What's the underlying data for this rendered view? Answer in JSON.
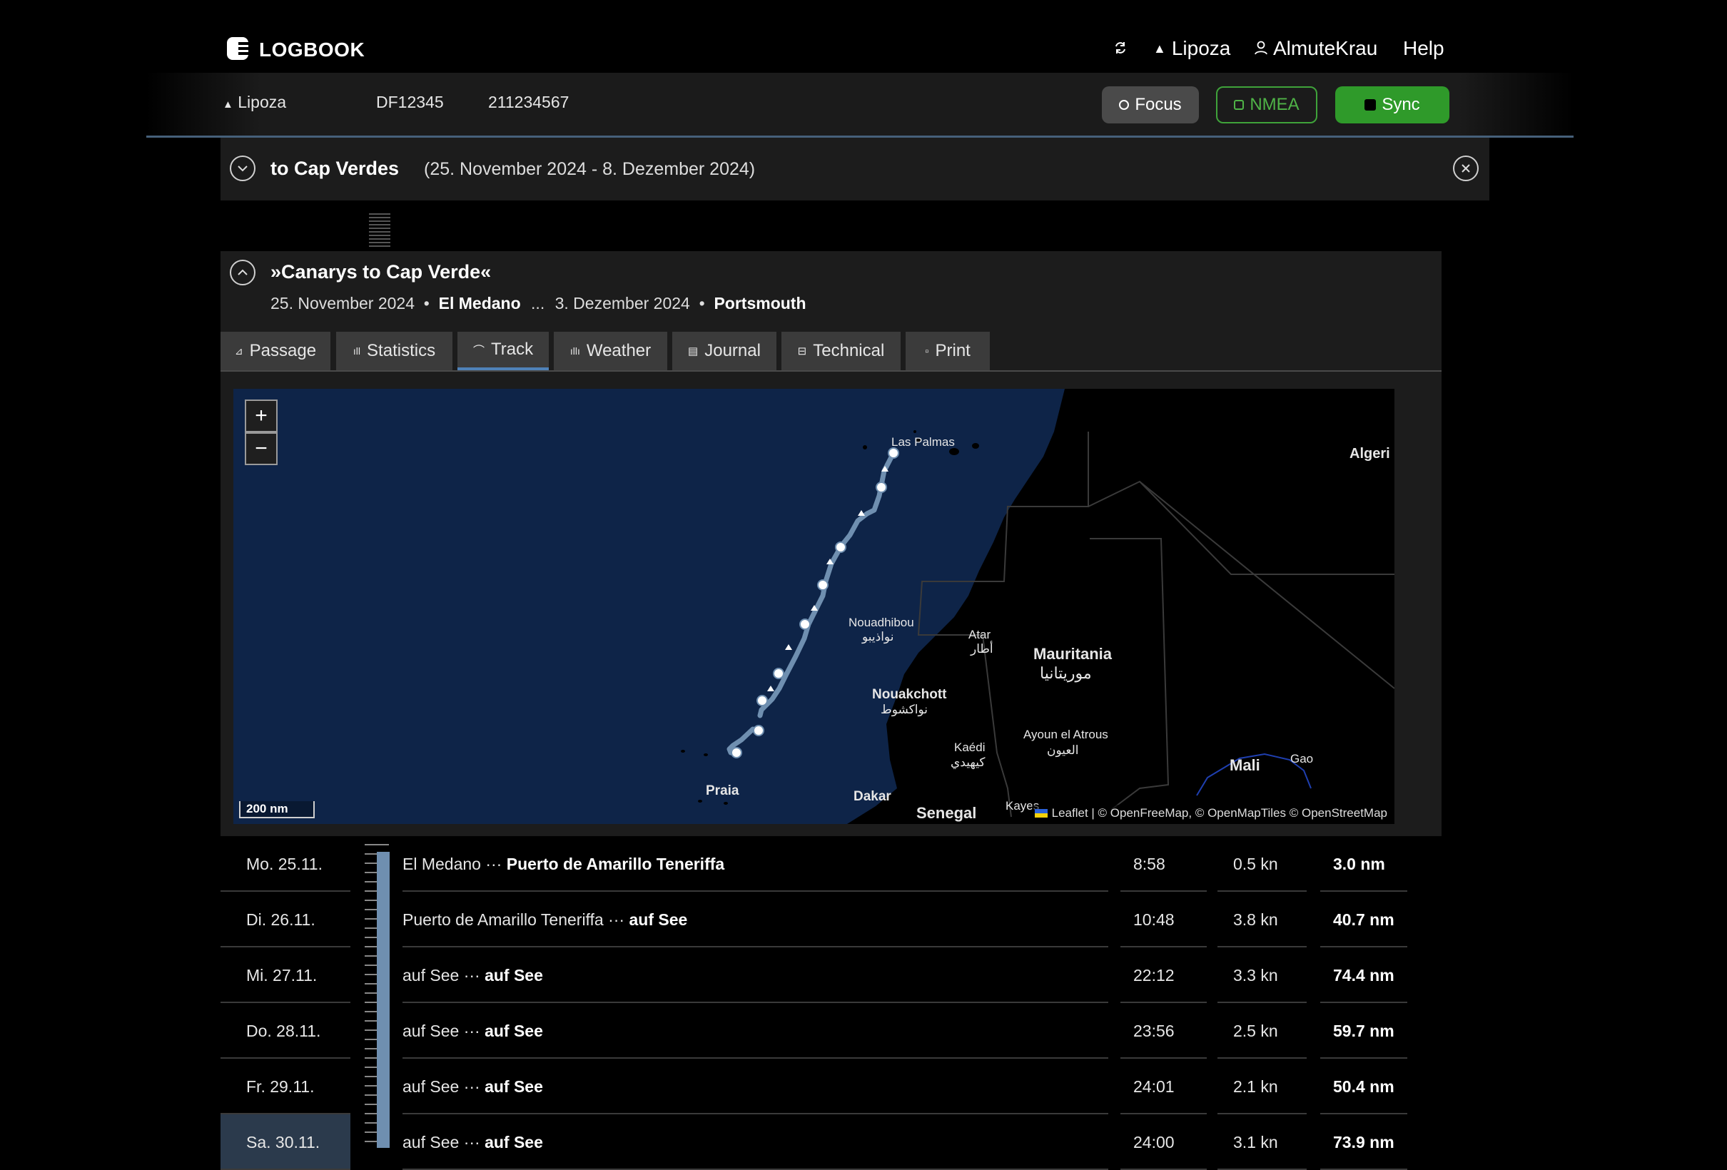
{
  "header": {
    "app_name": "LOGBOOK",
    "boat": "Lipoza",
    "user": "AlmuteKrau",
    "help": "Help"
  },
  "subbar": {
    "boat": "Lipoza",
    "callsign": "DF12345",
    "mmsi": "211234567",
    "focus_label": "Focus",
    "nmea_label": "NMEA",
    "sync_label": "Sync"
  },
  "trip": {
    "title": "to Cap Verdes",
    "dates": "(25. November 2024 - 8. Dezember 2024)"
  },
  "passage": {
    "title": "»Canarys to Cap Verde«",
    "start_date": "25. November 2024",
    "start_place": "El Medano",
    "ellipsis": "...",
    "end_date": "3. Dezember 2024",
    "end_place": "Portsmouth"
  },
  "tabs": [
    {
      "label": "Passage",
      "icon": "passage-icon"
    },
    {
      "label": "Statistics",
      "icon": "statistics-icon"
    },
    {
      "label": "Track",
      "icon": "track-icon",
      "active": true
    },
    {
      "label": "Weather",
      "icon": "weather-icon"
    },
    {
      "label": "Journal",
      "icon": "journal-icon"
    },
    {
      "label": "Technical",
      "icon": "technical-icon"
    },
    {
      "label": "Print",
      "icon": "print-icon"
    }
  ],
  "map": {
    "zoom_in": "+",
    "zoom_out": "−",
    "scale": "200 nm",
    "attribution": "Leaflet | © OpenFreeMap, © OpenMapTiles © OpenStreetMap",
    "labels": {
      "las_palmas": "Las Palmas",
      "algeria": "Algeri",
      "nouadhibou": "Nouadhibou",
      "nouadhibou_ar": "نواذيبو",
      "atar": "Atar",
      "atar_ar": "أطار",
      "mauritania": "Mauritania",
      "mauritania_ar": "موريتانيا",
      "nouakchott": "Nouakchott",
      "nouakchott_ar": "نواكشوط",
      "ayoun": "Ayoun el Atrous",
      "ayoun_ar": "العيون",
      "kaedi": "Kaédi",
      "kaedi_ar": "كيهيدي",
      "mali": "Mali",
      "gao": "Gao",
      "praia": "Praia",
      "dakar": "Dakar",
      "senegal": "Senegal",
      "kayes": "Kayes"
    },
    "colors": {
      "sea": "#0e2448",
      "land": "#000000",
      "track": "#6f8fb0"
    }
  },
  "days": [
    {
      "date": "Mo. 25.11.",
      "from": "El Medano",
      "sep": "···",
      "to": "Puerto de Amarillo Teneriffa",
      "time": "8:58",
      "speed": "0.5 kn",
      "distance": "3.0 nm"
    },
    {
      "date": "Di. 26.11.",
      "from": "Puerto de Amarillo Teneriffa",
      "sep": "···",
      "to": "auf See",
      "time": "10:48",
      "speed": "3.8 kn",
      "distance": "40.7 nm"
    },
    {
      "date": "Mi. 27.11.",
      "from": "auf See",
      "sep": "···",
      "to": "auf See",
      "time": "22:12",
      "speed": "3.3 kn",
      "distance": "74.4 nm"
    },
    {
      "date": "Do. 28.11.",
      "from": "auf See",
      "sep": "···",
      "to": "auf See",
      "time": "23:56",
      "speed": "2.5 kn",
      "distance": "59.7 nm"
    },
    {
      "date": "Fr. 29.11.",
      "from": "auf See",
      "sep": "···",
      "to": "auf See",
      "time": "24:01",
      "speed": "2.1 kn",
      "distance": "50.4 nm"
    },
    {
      "date": "Sa. 30.11.",
      "from": "auf See",
      "sep": "···",
      "to": "auf See",
      "time": "24:00",
      "speed": "3.1 kn",
      "distance": "73.9 nm"
    }
  ]
}
